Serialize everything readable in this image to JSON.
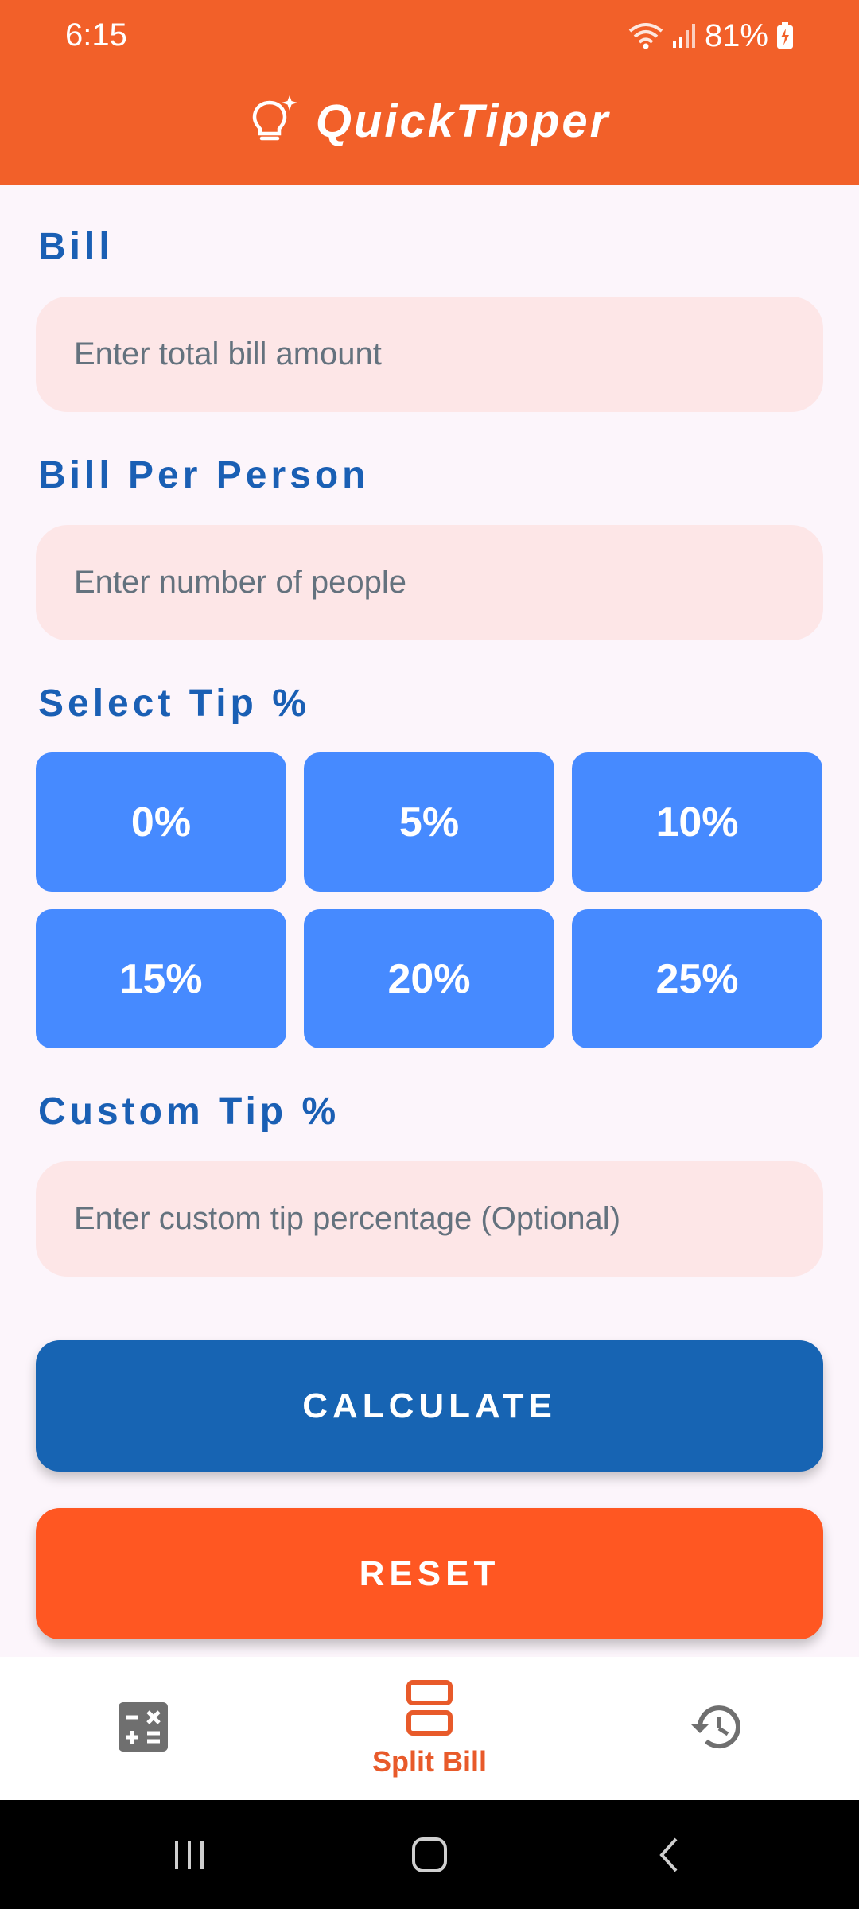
{
  "status": {
    "time": "6:15",
    "battery": "81%"
  },
  "header": {
    "title": "QuickTipper",
    "icon": "lightbulb-sparkle-icon"
  },
  "form": {
    "bill_label": "Bill",
    "bill_placeholder": "Enter total bill amount",
    "people_label": "Bill Per Person",
    "people_placeholder": "Enter number of people",
    "tip_label": "Select Tip %",
    "tip_options": [
      "0%",
      "5%",
      "10%",
      "15%",
      "20%",
      "25%"
    ],
    "custom_label": "Custom Tip %",
    "custom_placeholder": "Enter custom tip percentage (Optional)"
  },
  "actions": {
    "calculate": "CALCULATE",
    "reset": "RESET"
  },
  "bottom_nav": {
    "items": [
      {
        "icon": "calculator-icon",
        "label": ""
      },
      {
        "icon": "split-bill-icon",
        "label": "Split Bill",
        "selected": true
      },
      {
        "icon": "history-icon",
        "label": ""
      }
    ]
  },
  "colors": {
    "primary": "#F26029",
    "accent_blue": "#1A5FB4",
    "tip_button": "#468AFF",
    "calculate_button": "#1764B3",
    "reset_button": "#FF5722",
    "field_bg": "#FDE6E7",
    "page_bg": "#FCF5FB"
  }
}
